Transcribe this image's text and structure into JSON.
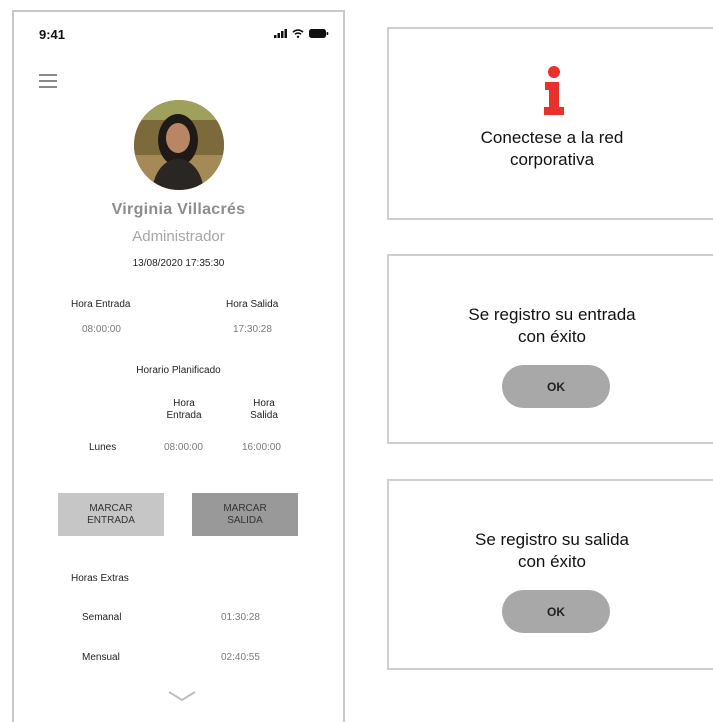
{
  "status": {
    "time": "9:41"
  },
  "profile": {
    "name": "Virginia Villacrés",
    "role": "Administrador",
    "datetime": "13/08/2020 17:35:30"
  },
  "attendance": {
    "entry_label": "Hora Entrada",
    "exit_label": "Hora Salida",
    "entry_value": "08:00:00",
    "exit_value": "17:30:28"
  },
  "schedule": {
    "title": "Horario Planificado",
    "col_entry": "Hora\nEntrada",
    "col_exit": "Hora\nSalida",
    "day": "Lunes",
    "entry": "08:00:00",
    "exit": "16:00:00"
  },
  "buttons": {
    "mark_entry": "MARCAR\nENTRADA",
    "mark_exit": "MARCAR\nSALIDA"
  },
  "overtime": {
    "title": "Horas Extras",
    "weekly_label": "Semanal",
    "weekly_value": "01:30:28",
    "monthly_label": "Mensual",
    "monthly_value": "02:40:55"
  },
  "dialogs": {
    "network": {
      "message": "Conectese a la red\ncorporativa",
      "icon": "info-icon",
      "icon_color": "#e8302d"
    },
    "entry_ok": {
      "message": "Se registro su entrada\ncon éxito",
      "button": "OK"
    },
    "exit_ok": {
      "message": "Se registro su salida\ncon éxito",
      "button": "OK"
    }
  }
}
